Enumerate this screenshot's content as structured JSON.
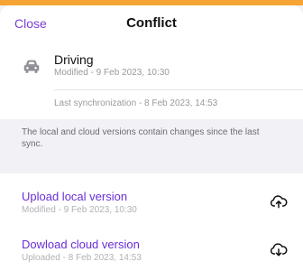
{
  "header": {
    "close_label": "Close",
    "title": "Conflict"
  },
  "item": {
    "icon": "car-icon",
    "title": "Driving",
    "modified": "Modified - 9 Feb 2023, 10:30",
    "last_sync": "Last synchronization - 8 Feb 2023, 14:53"
  },
  "note": "The local and cloud versions contain changes since the last sync.",
  "actions": [
    {
      "label": "Upload local version",
      "sub": "Modified - 9 Feb 2023, 10:30",
      "icon": "cloud-upload-icon"
    },
    {
      "label": "Dowload cloud version",
      "sub": "Uploaded - 8 Feb 2023, 14:53",
      "icon": "cloud-download-icon"
    }
  ],
  "colors": {
    "accent": "#6a2ed6",
    "top_strip": "#f4a533",
    "background": "#f2f1f6"
  }
}
